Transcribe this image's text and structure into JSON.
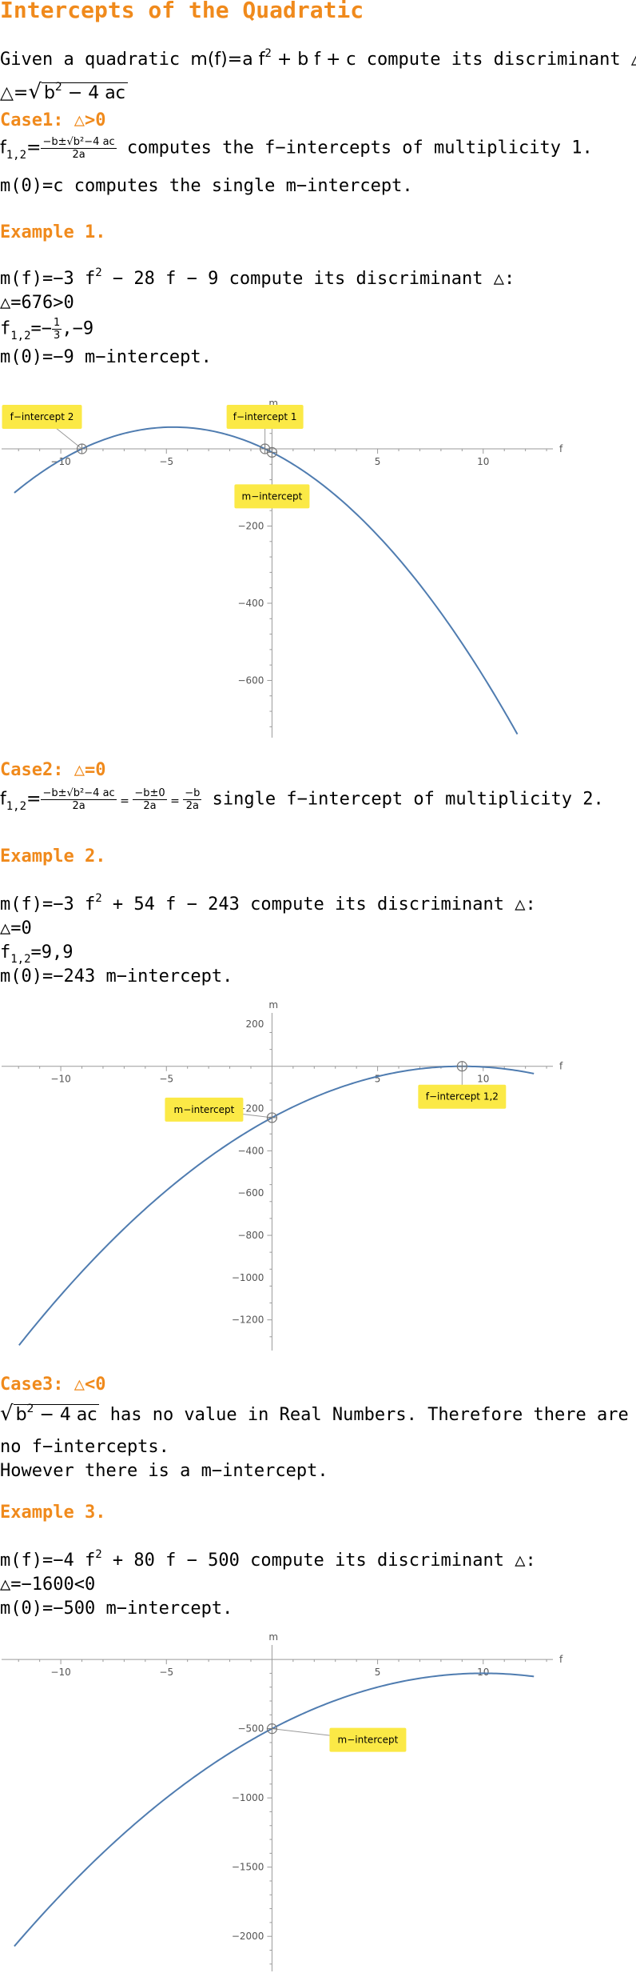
{
  "title": "Intercepts of the Quadratic",
  "intro": {
    "line1_pre": "Given a quadratic ",
    "line1_math": "m(f)=a f",
    "line1_math2": " + b f + c",
    "line1_post": " compute its discriminant △:",
    "disc_lhs": "△=",
    "disc_rad": "b",
    "disc_rad2": " − 4 ac"
  },
  "case1": {
    "head": "Case1: △>0",
    "f12": "f",
    "f12_sub": "1,2",
    "eq": "=",
    "frac_num": "−b±√b²−4 ac",
    "frac_den": "2a",
    "post": " computes the f−intercepts of multiplicity 1.",
    "m0": "m(0)=c computes the single m−intercept."
  },
  "example1": {
    "head": "Example 1.",
    "line1": "m(f)=−3 f",
    "line1b": " − 28 f − 9 compute its discriminant △:",
    "line2": "△=676>0",
    "line3a": "f",
    "line3sub": "1,2",
    "line3b": "=−",
    "frac_num": "1",
    "frac_den": "3",
    "line3c": ",−9",
    "line4": "m(0)=−9 m−intercept."
  },
  "case2": {
    "head": "Case2: △=0",
    "f12": "f",
    "f12_sub": "1,2",
    "eq": "=",
    "frac1_num": "−b±√b²−4 ac",
    "frac1_den": "2a",
    "frac2_num": "−b±0",
    "frac2_den": "2a",
    "frac3_num": "−b",
    "frac3_den": "2a",
    "post": " single f−intercept of multiplicity 2."
  },
  "example2": {
    "head": "Example 2.",
    "line1": "m(f)=−3 f",
    "line1b": " + 54 f − 243 compute its discriminant △:",
    "line2": "△=0",
    "line3a": "f",
    "line3sub": "1,2",
    "line3b": "=9,9",
    "line4": "m(0)=−243 m−intercept."
  },
  "case3": {
    "head": "Case3: △<0",
    "rad": "b",
    "rad2": " − 4 ac",
    "line1": " has no value in Real Numbers. Therefore there are",
    "line2": "no f−intercepts.",
    "line3": "However there is a m−intercept."
  },
  "example3": {
    "head": "Example 3.",
    "line1": "m(f)=−4 f",
    "line1b": " + 80 f − 500 compute its discriminant △:",
    "line2": "△=−1600<0",
    "line4": "m(0)=−500 m−intercept."
  },
  "colors": {
    "accent": "#f08a1c",
    "curve": "#4f7cb0",
    "label_bg": "#fbe946",
    "axis": "#9a9a9a"
  },
  "chart_data": [
    {
      "type": "line",
      "function": "m(f) = -3 f^2 - 28 f - 9",
      "coeffs": [
        -3,
        -28,
        -9
      ],
      "xlabel": "f",
      "ylabel": "m",
      "xlim": [
        -12.5,
        13.3
      ],
      "ylim": [
        -740,
        85
      ],
      "x_ticks": [
        -10,
        -5,
        5,
        10
      ],
      "y_ticks": [
        -200,
        -400,
        -600
      ],
      "grid": false,
      "points": [
        {
          "label": "f−intercept 2",
          "x": -9,
          "y": 0
        },
        {
          "label": "f−intercept 1",
          "x": -0.333,
          "y": 0
        },
        {
          "label": "m−intercept",
          "x": 0,
          "y": -9
        }
      ]
    },
    {
      "type": "line",
      "function": "m(f) = -3 f^2 + 54 f - 243",
      "coeffs": [
        -3,
        54,
        -243
      ],
      "xlabel": "f",
      "ylabel": "m",
      "xlim": [
        -12.5,
        13.3
      ],
      "ylim": [
        -1330,
        230
      ],
      "x_ticks": [
        -10,
        -5,
        5,
        10
      ],
      "y_ticks": [
        200,
        -200,
        -400,
        -600,
        -800,
        -1000,
        -1200
      ],
      "grid": false,
      "points": [
        {
          "label": "m−intercept",
          "x": 0,
          "y": -243
        },
        {
          "label": "f−intercept 1,2",
          "x": 9,
          "y": 0
        }
      ]
    },
    {
      "type": "line",
      "function": "m(f) = -4 f^2 + 80 f - 500",
      "coeffs": [
        -4,
        80,
        -500
      ],
      "xlabel": "f",
      "ylabel": "m",
      "xlim": [
        -12.5,
        13.3
      ],
      "ylim": [
        -2230,
        70
      ],
      "x_ticks": [
        -10,
        -5,
        5,
        10
      ],
      "y_ticks": [
        -500,
        -1000,
        -1500,
        -2000
      ],
      "grid": false,
      "points": [
        {
          "label": "m−intercept",
          "x": 0,
          "y": -500
        }
      ]
    }
  ]
}
